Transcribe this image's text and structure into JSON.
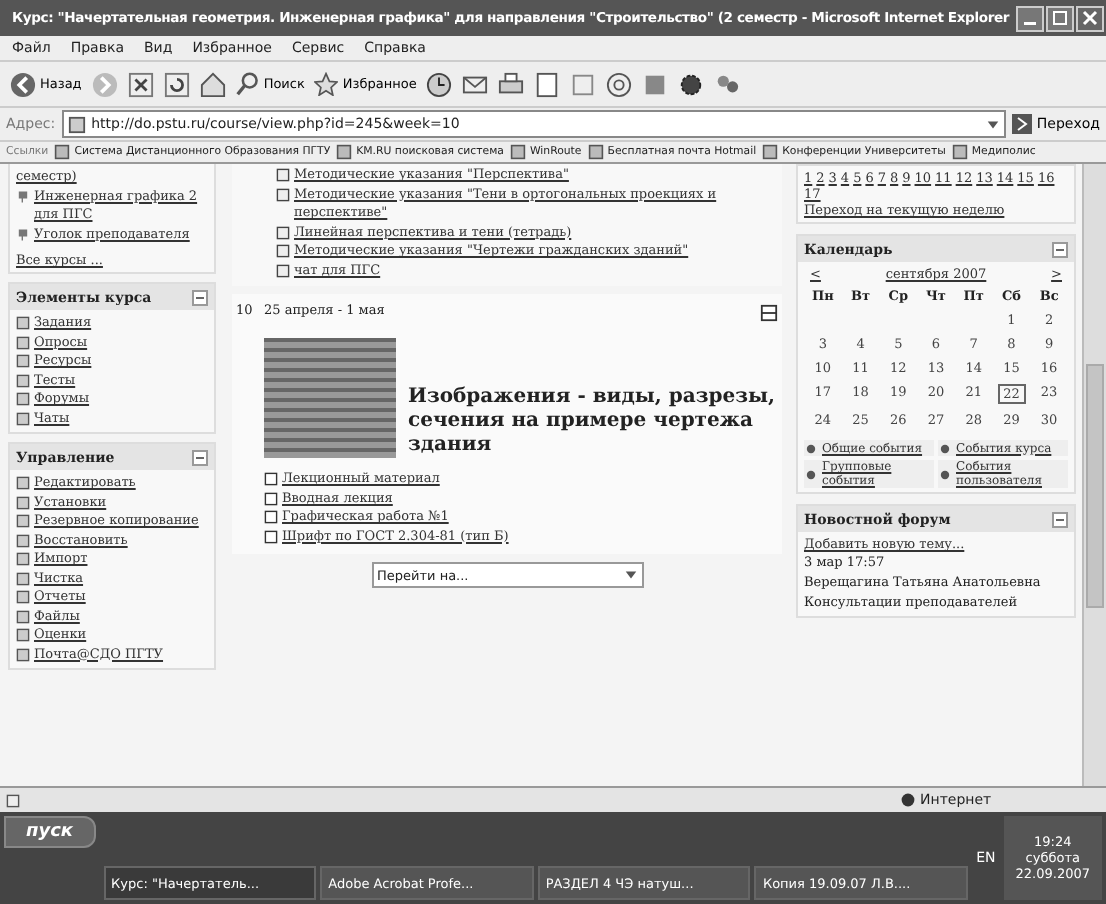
{
  "window": {
    "title": "Курс: \"Начертательная геометрия. Инженерная графика\" для направления \"Строительство\" (2 семестр - Microsoft Internet Explorer"
  },
  "menu": [
    "Файл",
    "Правка",
    "Вид",
    "Избранное",
    "Сервис",
    "Справка"
  ],
  "toolbar": {
    "back": "Назад",
    "search": "Поиск",
    "favorites": "Избранное"
  },
  "address": {
    "label": "Адрес:",
    "value": "http://do.pstu.ru/course/view.php?id=245&week=10",
    "go": "Переход"
  },
  "links": {
    "label": "Ссылки",
    "items": [
      "Система Дистанционного Образования ПГТУ",
      "KM.RU поисковая система",
      "WinRoute",
      "Бесплатная почта Hotmail",
      "Конференции Университеты",
      "Медиполис"
    ]
  },
  "left": {
    "courses": [
      "семестр)",
      "Инженерная графика 2 для ПГС",
      "Уголок преподавателя"
    ],
    "all_courses": "Все курсы ...",
    "blocks": [
      {
        "title": "Элементы курса",
        "items": [
          "Задания",
          "Опросы",
          "Ресурсы",
          "Тесты",
          "Форумы",
          "Чаты"
        ]
      },
      {
        "title": "Управление",
        "items": [
          "Редактировать",
          "Установки",
          "Резервное копирование",
          "Восстановить",
          "Импорт",
          "Чистка",
          "Отчеты",
          "Файлы",
          "Оценки",
          "Почта@СДО ПГТУ"
        ]
      }
    ]
  },
  "center": {
    "top_links": [
      "Методические указания \"Перспектива\"",
      "Методические указания \"Тени в ортогональных проекциях и перспективе\"",
      "Линейная перспектива и тени (тетрадь)",
      "Методические указания \"Чертежи гражданских зданий\"",
      "чат для ПГС"
    ],
    "week": {
      "number": "10",
      "dates": "25 апреля - 1 мая",
      "heading": "Изображения - виды, разрезы, сечения на примере чертежа здания",
      "resources": [
        "Лекционный материал",
        "Вводная лекция",
        "Графическая работа №1",
        "Шрифт по ГОСТ 2.304-81 (тип Б)"
      ]
    },
    "jump": {
      "placeholder": "Перейти на..."
    }
  },
  "right": {
    "weeks": [
      "1",
      "2",
      "3",
      "4",
      "5",
      "6",
      "7",
      "8",
      "9",
      "10",
      "11",
      "12",
      "13",
      "14",
      "15",
      "16",
      "17"
    ],
    "current_week_link": "Переход на текущую неделю",
    "calendar": {
      "title": "Календарь",
      "prev": "<",
      "month": "сентября 2007",
      "next": ">",
      "weekdays": [
        "Пн",
        "Вт",
        "Ср",
        "Чт",
        "Пт",
        "Сб",
        "Вс"
      ],
      "rows": [
        [
          null,
          null,
          null,
          null,
          null,
          {
            "day": "1",
            "selected": false
          },
          {
            "day": "2",
            "selected": false
          }
        ],
        [
          {
            "day": "3",
            "selected": false
          },
          {
            "day": "4",
            "selected": false
          },
          {
            "day": "5",
            "selected": false
          },
          {
            "day": "6",
            "selected": false
          },
          {
            "day": "7",
            "selected": false
          },
          {
            "day": "8",
            "selected": false
          },
          {
            "day": "9",
            "selected": false
          }
        ],
        [
          {
            "day": "10",
            "selected": false
          },
          {
            "day": "11",
            "selected": false
          },
          {
            "day": "12",
            "selected": false
          },
          {
            "day": "13",
            "selected": false
          },
          {
            "day": "14",
            "selected": false
          },
          {
            "day": "15",
            "selected": false
          },
          {
            "day": "16",
            "selected": false
          }
        ],
        [
          {
            "day": "17",
            "selected": false
          },
          {
            "day": "18",
            "selected": false
          },
          {
            "day": "19",
            "selected": false
          },
          {
            "day": "20",
            "selected": false
          },
          {
            "day": "21",
            "selected": false
          },
          {
            "day": "22",
            "selected": true
          },
          {
            "day": "23",
            "selected": false
          }
        ],
        [
          {
            "day": "24",
            "selected": false
          },
          {
            "day": "25",
            "selected": false
          },
          {
            "day": "26",
            "selected": false
          },
          {
            "day": "27",
            "selected": false
          },
          {
            "day": "28",
            "selected": false
          },
          {
            "day": "29",
            "selected": false
          },
          {
            "day": "30",
            "selected": false
          }
        ]
      ],
      "legend": [
        "Общие события",
        "События курса",
        "Групповые события",
        "События пользователя"
      ]
    },
    "news": {
      "title": "Новостной форум",
      "add": "Добавить новую тему...",
      "date": "3 мар 17:57",
      "author": "Верещагина Татьяна Анатольевна",
      "subject": "Консультации преподавателей"
    }
  },
  "status_bar": {
    "zone": "Интернет"
  },
  "taskbar": {
    "start": "пуск",
    "tasks": [
      "Курс: \"Начертатель...",
      "Adobe Acrobat Profe...",
      "РАЗДЕЛ 4 ЧЭ натуш...",
      "Копия 19.09.07 Л.В...."
    ],
    "lang": "EN",
    "time": "19:24",
    "day": "суббота",
    "date": "22.09.2007"
  }
}
